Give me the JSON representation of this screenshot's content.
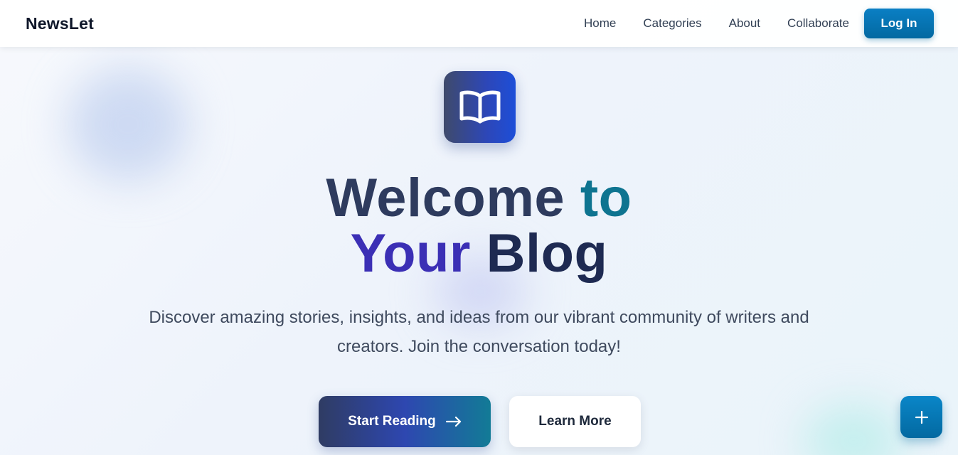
{
  "brand": {
    "name": "NewsLet"
  },
  "nav": {
    "links": [
      "Home",
      "Categories",
      "About",
      "Collaborate"
    ],
    "login_label": "Log In"
  },
  "hero": {
    "icon": "open-book-icon",
    "title_line1_a": "Welcome",
    "title_line1_b": "to",
    "title_line2_a": "Your",
    "title_line2_b": "Blog",
    "subtitle": "Discover amazing stories, insights, and ideas from our vibrant community of writers and creators. Join the conversation today!",
    "primary_cta": "Start Reading",
    "secondary_cta": "Learn More"
  },
  "fab": {
    "icon": "plus-icon"
  },
  "colors": {
    "accent": "#0369a1",
    "brand_gradient_start": "#2f3c63",
    "brand_gradient_end": "#127b96",
    "title_purple": "#3b2fb5",
    "title_teal": "#0e7490"
  }
}
